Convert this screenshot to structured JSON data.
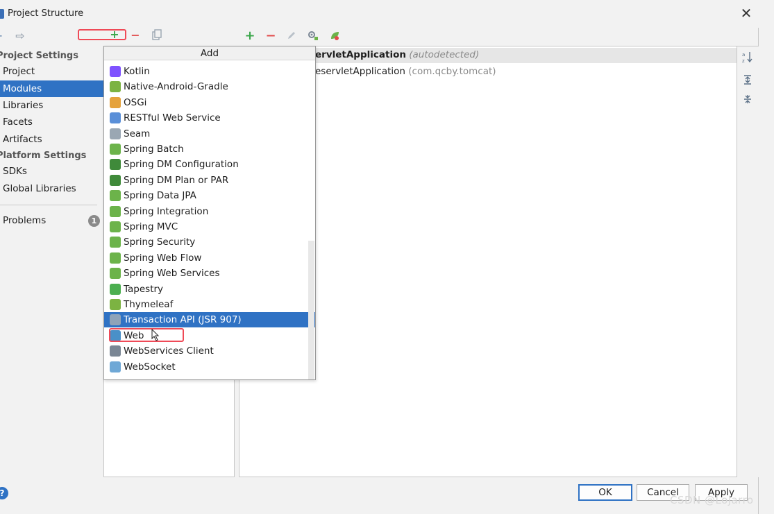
{
  "window": {
    "title": "Project Structure",
    "close_glyph": "✕"
  },
  "left_toolbar": {
    "back_icon": "back-arrow-icon",
    "forward_icon": "forward-arrow-icon",
    "add_glyph": "+",
    "remove_glyph": "−",
    "copy_icon": "copy-icon"
  },
  "sidebar": {
    "project_settings_header": "Project Settings",
    "items_top": [
      "Project",
      "Modules",
      "Libraries",
      "Facets",
      "Artifacts"
    ],
    "platform_settings_header": "Platform Settings",
    "items_bottom": [
      "SDKs",
      "Global Libraries"
    ],
    "problems_label": "Problems",
    "problems_count": "1",
    "selected": "Modules"
  },
  "right_toolbar": {
    "add_glyph": "+",
    "remove_glyph": "−",
    "edit_icon": "pencil-icon",
    "configure_icon": "configure-icon",
    "spring_icon": "spring-leaf-icon"
  },
  "right_panel": {
    "row1_name": "ervletApplication",
    "row1_note": "(autodetected)",
    "row2_name": "eservletApplication",
    "row2_note": "(com.qcby.tomcat)"
  },
  "right_strip": {
    "sort_icon": "sort-alpha-icon",
    "expand_icon": "expand-all-icon",
    "collapse_icon": "collapse-all-icon"
  },
  "add_popup": {
    "header": "Add",
    "items": [
      {
        "label": "Kotlin",
        "icon": "kotlin-icon",
        "color": "#7f52ff"
      },
      {
        "label": "Native-Android-Gradle",
        "icon": "android-icon",
        "color": "#7cb342"
      },
      {
        "label": "OSGi",
        "icon": "osgi-icon",
        "color": "#e5a23c"
      },
      {
        "label": "RESTful Web Service",
        "icon": "rest-feather-icon",
        "color": "#5a8fd8"
      },
      {
        "label": "Seam",
        "icon": "seam-icon",
        "color": "#9aa7b3"
      },
      {
        "label": "Spring Batch",
        "icon": "spring-batch-icon",
        "color": "#6cb34a"
      },
      {
        "label": "Spring DM Configuration",
        "icon": "spring-dm-icon",
        "color": "#3f8a3a"
      },
      {
        "label": "Spring DM Plan or PAR",
        "icon": "spring-dm-plan-icon",
        "color": "#3f8a3a"
      },
      {
        "label": "Spring Data JPA",
        "icon": "spring-data-icon",
        "color": "#6cb34a"
      },
      {
        "label": "Spring Integration",
        "icon": "spring-integration-icon",
        "color": "#6cb34a"
      },
      {
        "label": "Spring MVC",
        "icon": "spring-mvc-icon",
        "color": "#6cb34a"
      },
      {
        "label": "Spring Security",
        "icon": "spring-security-icon",
        "color": "#6cb34a"
      },
      {
        "label": "Spring Web Flow",
        "icon": "spring-webflow-icon",
        "color": "#6cb34a"
      },
      {
        "label": "Spring Web Services",
        "icon": "spring-ws-icon",
        "color": "#6cb34a"
      },
      {
        "label": "Tapestry",
        "icon": "tapestry-icon",
        "color": "#4caf50"
      },
      {
        "label": "Thymeleaf",
        "icon": "thymeleaf-icon",
        "color": "#7cb342"
      },
      {
        "label": "Transaction API (JSR 907)",
        "icon": "transaction-icon",
        "color": "#8fa3b8"
      },
      {
        "label": "Web",
        "icon": "web-icon",
        "color": "#4a90c8"
      },
      {
        "label": "WebServices Client",
        "icon": "webservices-gear-icon",
        "color": "#7a8694"
      },
      {
        "label": "WebSocket",
        "icon": "websocket-icon",
        "color": "#6fa8d6"
      }
    ],
    "selected": "Transaction API (JSR 907)",
    "highlighted": "Web"
  },
  "footer": {
    "ok_label": "OK",
    "cancel_label": "Cancel",
    "apply_label": "Apply",
    "help_glyph": "?"
  },
  "watermark": "CSDN @Lojarro",
  "colors": {
    "selection_blue": "#2f72c4",
    "highlight_red": "#ef4a57",
    "add_green": "#3aa64a",
    "remove_red": "#e24c4c"
  }
}
